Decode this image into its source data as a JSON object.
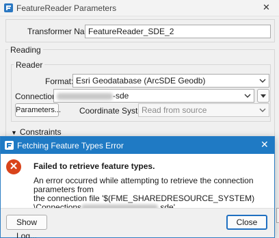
{
  "bg_window": {
    "title": "FeatureReader Parameters",
    "close_glyph": "✕",
    "transformer_name_label": "Transformer Name:",
    "transformer_name_value": "FeatureReader_SDE_2",
    "reading_group_title": "Reading",
    "reader_group_title": "Reader",
    "format_label": "Format:",
    "format_value": "Esri Geodatabase (ArcSDE Geodb)",
    "connection_label": "Connection:",
    "connection_value_suffix": "-sde",
    "parameters_button": "Parameters...",
    "coordinate_system_label": "Coordinate System:",
    "coordinate_system_value": "Read from source",
    "constraints_label": "Constraints"
  },
  "dialog": {
    "title": "Fetching Feature Types Error",
    "close_glyph": "✕",
    "error_icon_glyph": "✕",
    "heading": "Failed to retrieve feature types.",
    "body_line1": "An error occurred while attempting to retrieve the connection parameters from",
    "body_line2": "the connection file '$(FME_SHAREDRESOURCE_SYSTEM)",
    "body_line3_prefix": "\\Connections",
    "body_line3_suffix": ".sde'",
    "show_log_button": "Show Log...",
    "close_button": "Close"
  },
  "colors": {
    "dialog_titlebar": "#1f7ac4",
    "error_icon": "#d9441b",
    "primary_border": "#1f6fc0"
  },
  "icons": {
    "app": "fme-app-icon",
    "error": "error-icon",
    "dropdown": "chevron-down-icon"
  }
}
